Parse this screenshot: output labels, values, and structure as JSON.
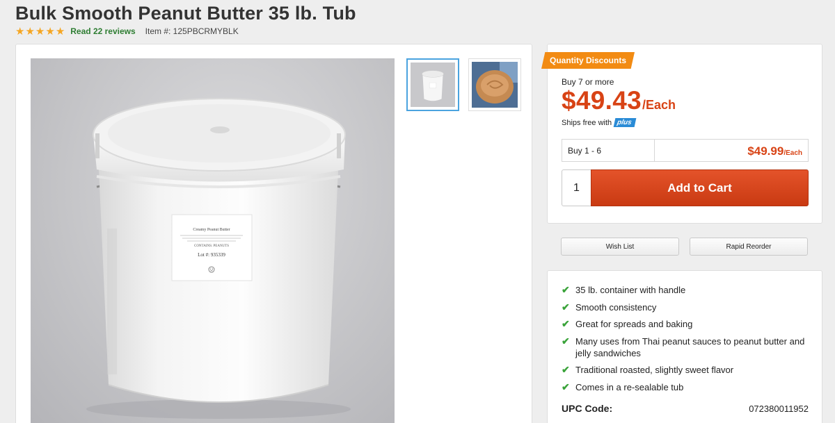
{
  "product": {
    "title": "Bulk Smooth Peanut Butter 35 lb. Tub",
    "rating": 5,
    "reviews_link": "Read 22 reviews",
    "item_number": "Item #: 125PBCRMYBLK"
  },
  "image": {
    "label_title": "Creamy Peanut Butter",
    "label_contains": "CONTAINS: PEANUTS",
    "label_lot": "Lot #: 935339",
    "label_mark": "U"
  },
  "pricing": {
    "badge": "Quantity Discounts",
    "bulk_qty_label": "Buy 7 or more",
    "bulk_price": "$49.43",
    "bulk_unit": "/Each",
    "ships_text": "Ships free with",
    "plus_badge": "plus",
    "tier_qty": "Buy 1 - 6",
    "tier_price": "$49.99",
    "tier_unit": "/Each",
    "quantity": "1",
    "add_to_cart": "Add to Cart"
  },
  "actions": {
    "wish_list": "Wish List",
    "rapid_reorder": "Rapid Reorder"
  },
  "features": [
    "35 lb. container with handle",
    "Smooth consistency",
    "Great for spreads and baking",
    "Many uses from Thai peanut sauces to peanut butter and jelly sandwiches",
    "Traditional roasted, slightly sweet flavor",
    "Comes in a re-sealable tub"
  ],
  "upc": {
    "label": "UPC Code:",
    "value": "072380011952"
  },
  "colors": {
    "price": "#d84315",
    "badge": "#f28b13",
    "rating": "#f5a623",
    "reviews": "#2e7d32",
    "plus": "#2a8bd6"
  }
}
